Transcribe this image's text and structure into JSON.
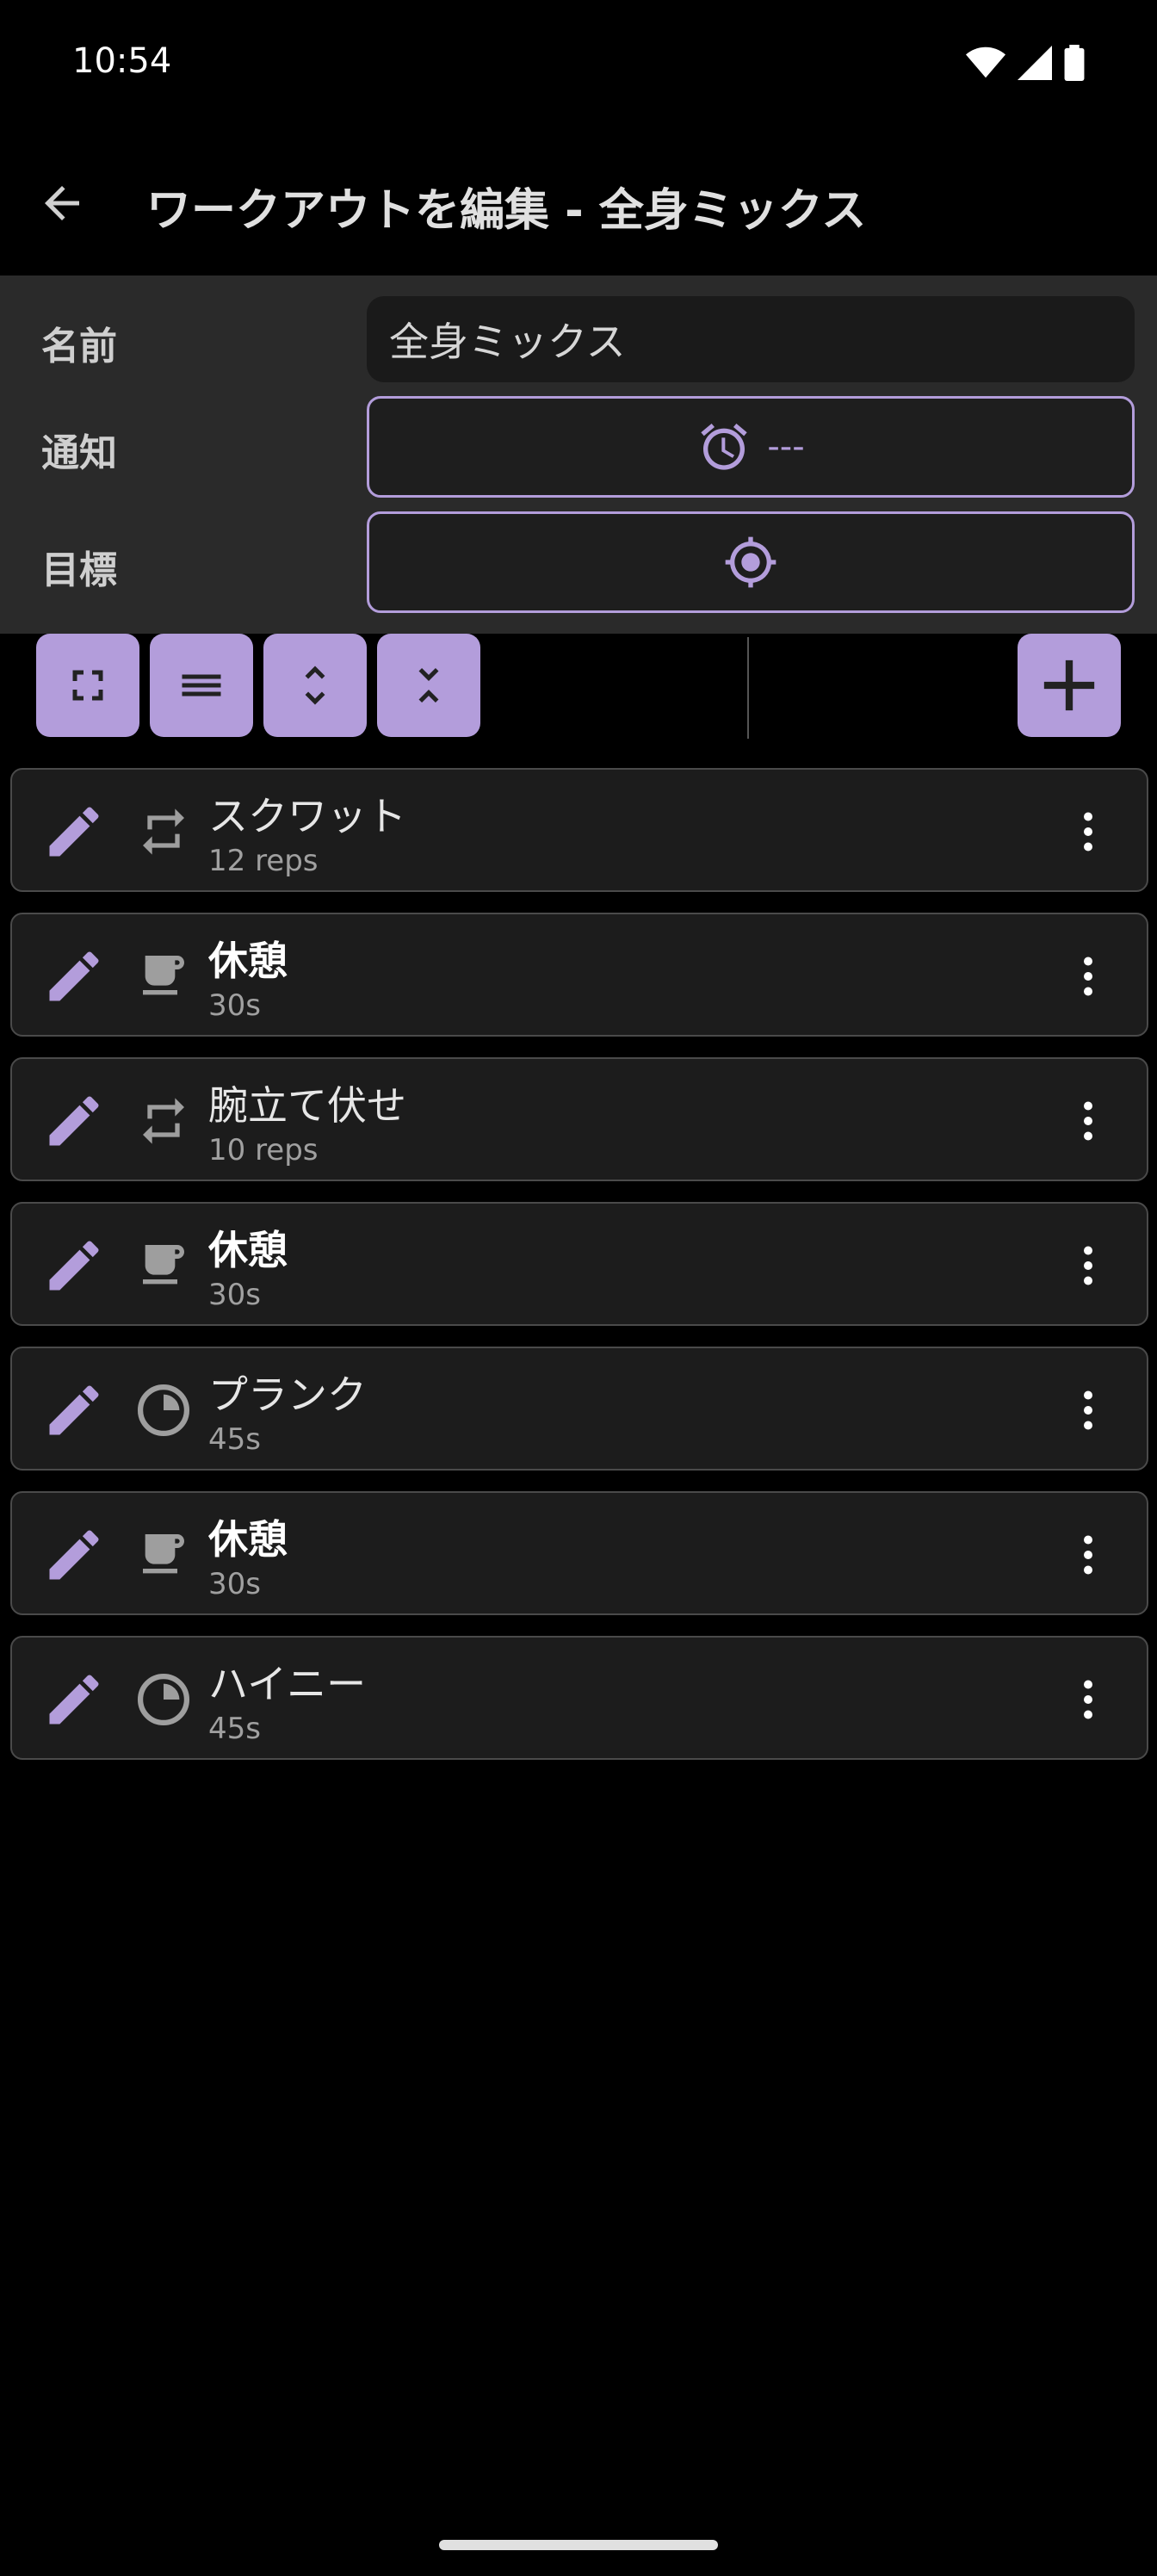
{
  "status_bar": {
    "time": "10:54"
  },
  "app_bar": {
    "title": "ワークアウトを編集 - 全身ミックス"
  },
  "form": {
    "name_label": "名前",
    "name_value": "全身ミックス",
    "notification_label": "通知",
    "notification_value": "---",
    "goal_label": "目標"
  },
  "toolbar": {
    "buttons": [
      "expand-icon",
      "menu-lines-icon",
      "expand-vertical-icon",
      "collapse-vertical-icon"
    ],
    "add": "plus-icon"
  },
  "items": [
    {
      "name": "スクワット",
      "detail": "12 reps",
      "type": "repeat-icon",
      "rest": false
    },
    {
      "name": "休憩",
      "detail": "30s",
      "type": "coffee-cup-icon",
      "rest": true
    },
    {
      "name": "腕立て伏せ",
      "detail": "10 reps",
      "type": "repeat-icon",
      "rest": false
    },
    {
      "name": "休憩",
      "detail": "30s",
      "type": "coffee-cup-icon",
      "rest": true
    },
    {
      "name": "プランク",
      "detail": "45s",
      "type": "timer-icon",
      "rest": false
    },
    {
      "name": "休憩",
      "detail": "30s",
      "type": "coffee-cup-icon",
      "rest": true
    },
    {
      "name": "ハイニー",
      "detail": "45s",
      "type": "timer-icon",
      "rest": false
    }
  ],
  "colors": {
    "accent": "#b39ddb",
    "background": "#000000",
    "form_background": "#2a2a2a",
    "item_background": "#1c1c1c"
  }
}
